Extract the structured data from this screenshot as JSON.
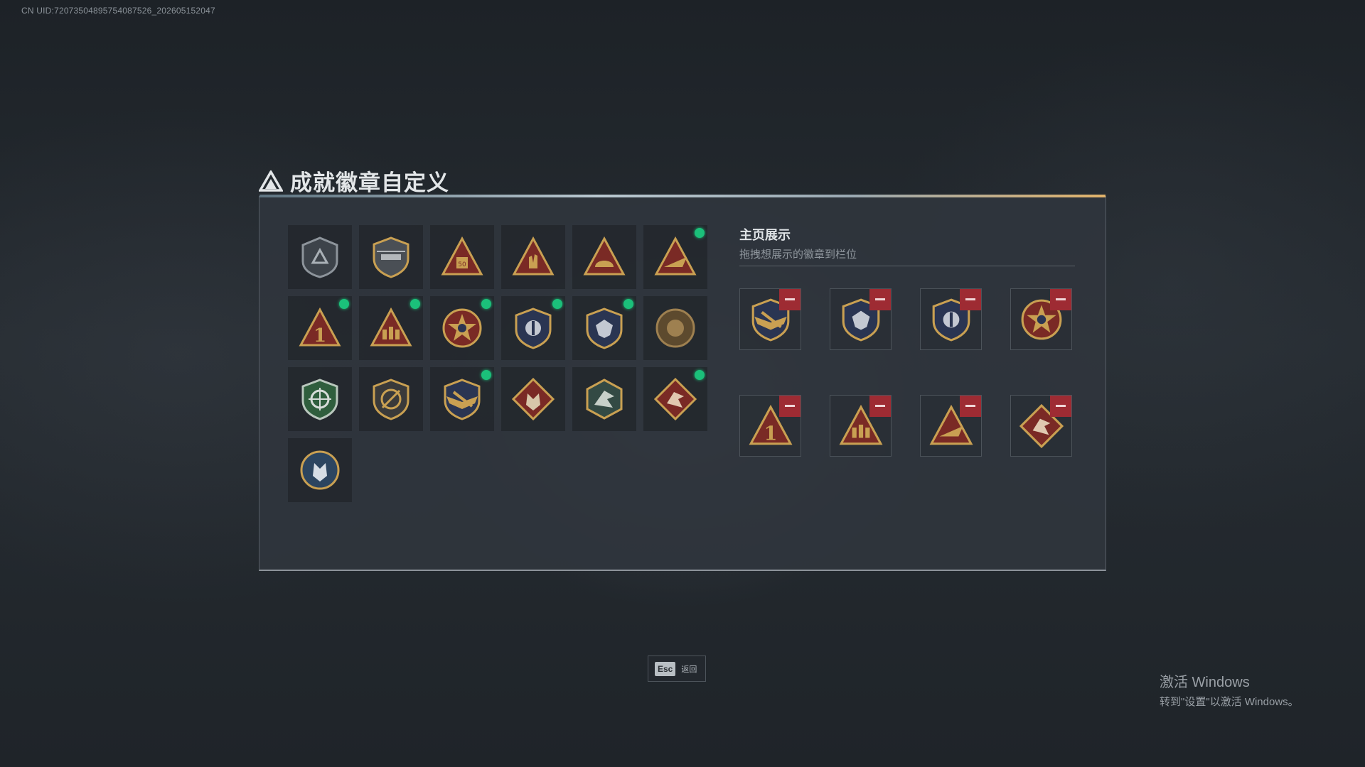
{
  "uid_text": "CN UID:72073504895754087526_202605152047",
  "title": "成就徽章自定义",
  "showcase": {
    "title": "主页展示",
    "subtitle": "拖拽想展示的徽章到栏位"
  },
  "badges": [
    {
      "icon": "grey-shield-emblem-icon",
      "new": false
    },
    {
      "icon": "helicopter-shield-badge-icon",
      "new": false
    },
    {
      "icon": "fifty-triangle-badge-icon",
      "new": false
    },
    {
      "icon": "hand-triangle-badge-icon",
      "new": false
    },
    {
      "icon": "helmet-triangle-badge-icon",
      "new": false
    },
    {
      "icon": "jet-triangle-badge-icon",
      "new": true
    },
    {
      "icon": "number-one-triangle-badge-icon",
      "new": true
    },
    {
      "icon": "soldiers-triangle-badge-icon",
      "new": true
    },
    {
      "icon": "star-medal-badge-icon",
      "new": true
    },
    {
      "icon": "police-shield-badge-icon",
      "new": true
    },
    {
      "icon": "eagle-shield-badge-icon",
      "new": true
    },
    {
      "icon": "bronze-round-badge-icon",
      "new": false
    },
    {
      "icon": "green-crosshair-shield-icon",
      "new": false
    },
    {
      "icon": "rifle-shield-badge-icon",
      "new": false
    },
    {
      "icon": "winged-rifle-emblem-icon",
      "new": true
    },
    {
      "icon": "wolf-diamond-badge-icon",
      "new": false
    },
    {
      "icon": "dragon-hexagon-badge-icon",
      "new": false
    },
    {
      "icon": "dragon-diamond-badge-icon",
      "new": true
    },
    {
      "icon": "wolf-round-badge-icon",
      "new": false
    }
  ],
  "displayed_badges": [
    {
      "icon": "winged-rifle-emblem-icon"
    },
    {
      "icon": "eagle-shield-badge-icon"
    },
    {
      "icon": "police-shield-badge-icon"
    },
    {
      "icon": "star-medal-badge-icon"
    },
    {
      "icon": "number-one-triangle-badge-icon"
    },
    {
      "icon": "soldiers-triangle-badge-icon"
    },
    {
      "icon": "jet-triangle-badge-icon"
    },
    {
      "icon": "dragon-diamond-badge-icon"
    }
  ],
  "footer": {
    "key": "Esc",
    "label": "返回"
  },
  "windows": {
    "line1": "激活 Windows",
    "line2": "转到\"设置\"以激活 Windows。"
  },
  "colors": {
    "new_dot": "#1bc07a",
    "remove_button": "#9e2b33",
    "gold": "#c9a052",
    "crimson": "#7a2a25",
    "navy": "#2a3552",
    "green": "#2f5e3d"
  }
}
